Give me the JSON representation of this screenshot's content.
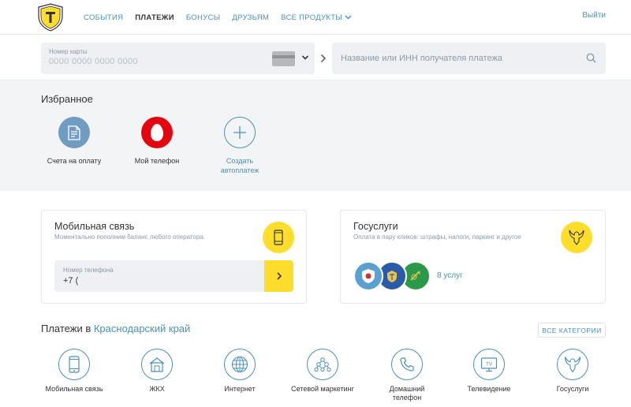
{
  "header": {
    "nav": [
      {
        "label": "СОБЫТИЯ",
        "active": false
      },
      {
        "label": "ПЛАТЕЖИ",
        "active": true
      },
      {
        "label": "БОНУСЫ",
        "active": false
      },
      {
        "label": "ДРУЗЬЯМ",
        "active": false
      },
      {
        "label": "ВСЕ ПРОДУКТЫ",
        "active": false
      }
    ],
    "logout": "Выйти"
  },
  "search": {
    "card_label": "Номер карты",
    "card_placeholder": "0000 0000 0000 0000",
    "payee_placeholder": "Название или ИНН получателя платежа"
  },
  "favorites": {
    "title": "Избранное",
    "items": [
      {
        "label": "Счета на оплату",
        "icon": "invoice-icon"
      },
      {
        "label": "Мой телефон",
        "icon": "mts-logo-icon"
      },
      {
        "label": "Создать автоплатеж",
        "icon": "plus-icon"
      }
    ]
  },
  "mobile_card": {
    "title": "Мобильная связь",
    "subtitle": "Моментально пополним баланс любого оператора.",
    "phone_label": "Номер телефона",
    "phone_value": "+7 ("
  },
  "gos_card": {
    "title": "Госуслуги",
    "subtitle": "Оплата в пару кликов: штрафы, налоги, паркинг и другое",
    "count": "8 услуг"
  },
  "region": {
    "prefix": "Платежи в ",
    "name": "Краснодарский край",
    "all_categories": "ВСЕ КАТЕГОРИИ",
    "categories": [
      {
        "label": "Мобильная связь",
        "icon": "mobile-icon"
      },
      {
        "label": "ЖКХ",
        "icon": "house-icon"
      },
      {
        "label": "Интернет",
        "icon": "globe-icon"
      },
      {
        "label": "Сетевой маркетинг",
        "icon": "network-icon"
      },
      {
        "label": "Домашний телефон",
        "icon": "phone-handset-icon"
      },
      {
        "label": "Телевидение",
        "icon": "tv-icon"
      },
      {
        "label": "Госуслуги",
        "icon": "eagle-icon"
      }
    ]
  },
  "colors": {
    "accent": "#4a90b8",
    "yellow": "#ffdd2d",
    "mts_red": "#e30611",
    "invoice_blue": "#6f9cc0"
  }
}
